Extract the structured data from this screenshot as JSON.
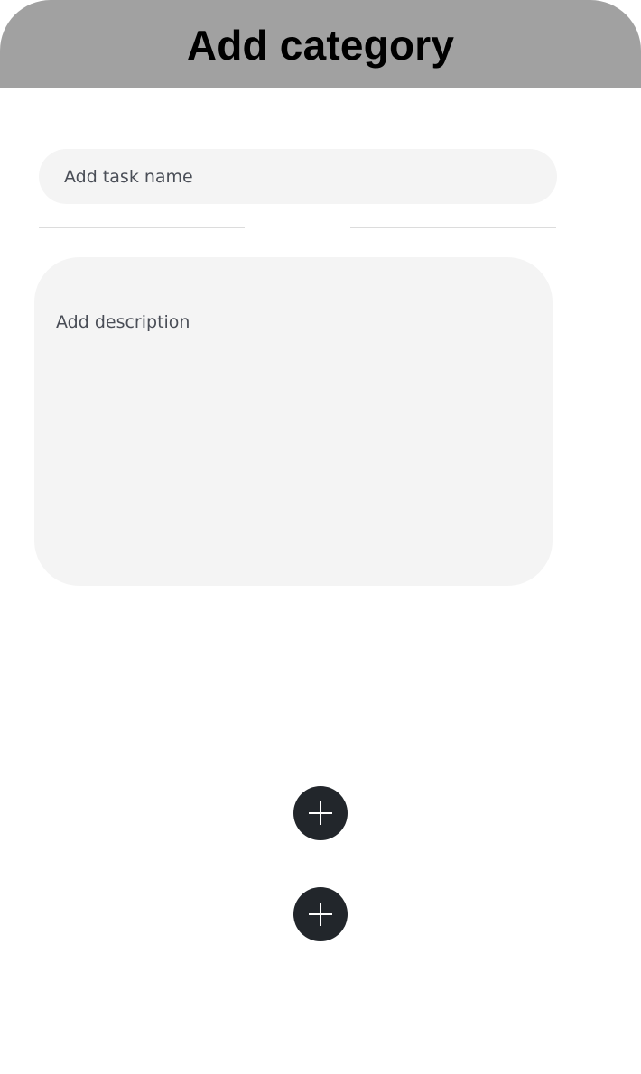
{
  "header": {
    "title": "Add category",
    "background_color": "#a1a1a1"
  },
  "form": {
    "task_name_placeholder": "Add task name",
    "description_placeholder": "Add description",
    "field_background": "#f4f4f4"
  },
  "actions": [
    {
      "icon": "plus-icon",
      "color": "#22262b"
    },
    {
      "icon": "plus-icon",
      "color": "#22262b"
    }
  ]
}
